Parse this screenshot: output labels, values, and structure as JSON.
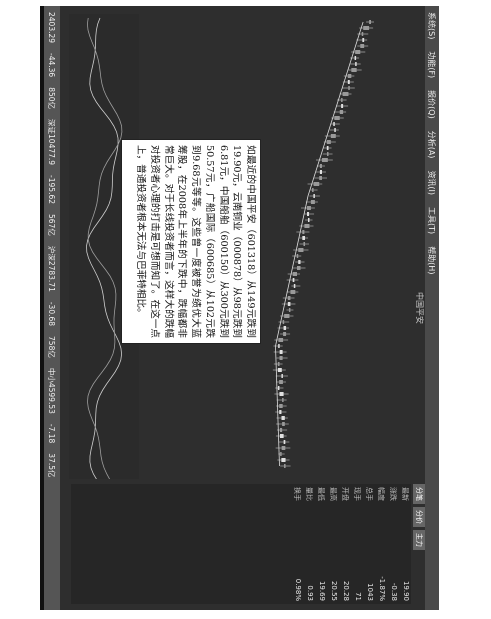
{
  "menubar": {
    "items": [
      "系统(S)",
      "功能(F)",
      "报价(Q)",
      "分析(A)",
      "资讯(I)",
      "工具(T)",
      "帮助(H)"
    ]
  },
  "chart_title": "中国平安",
  "right_buttons": [
    "分笔",
    "分价",
    "主力"
  ],
  "side_panel": {
    "rows": [
      {
        "label": "最新",
        "value": "19.90"
      },
      {
        "label": "涨跌",
        "value": "-0.38"
      },
      {
        "label": "幅度",
        "value": "-1.87%"
      },
      {
        "label": "总手",
        "value": "1043"
      },
      {
        "label": "现手",
        "value": "71"
      },
      {
        "label": "开盘",
        "value": "20.28"
      },
      {
        "label": "最高",
        "value": "20.55"
      },
      {
        "label": "最低",
        "value": "19.69"
      },
      {
        "label": "量比",
        "value": "0.93"
      },
      {
        "label": "换手",
        "value": "0.98%"
      }
    ]
  },
  "statusbar": {
    "items": [
      "2403.29",
      "-44.36",
      "850亿",
      "深证10477.9",
      "-195.62",
      "567亿",
      "沪深2783.71",
      "-30.68",
      "758亿",
      "中小4599.53",
      "-7.18",
      "37.5亿"
    ]
  },
  "note": {
    "text": "如最近的中国平安（601318）从149元跌到19.90元，云南铜业（000878）从98元跌到6.81元，中国船舶（600150）从300元跌到50.57元，广船国际（600685）从102元跌到9.68元等等。这些曾一度被誉为绩优大蓝筹股，在2008年上半年的下跌中，跌幅都非常巨大。对于长线投资者而言，这样大的跌幅对投资者心理的打击是可想而知了。在这一点上，普通投资者根本无法与巴菲特相比。"
  },
  "colors": {
    "background": "#2e2e2e",
    "candle_up": "#e0e0e0",
    "candle_down": "#9a9a9a"
  }
}
